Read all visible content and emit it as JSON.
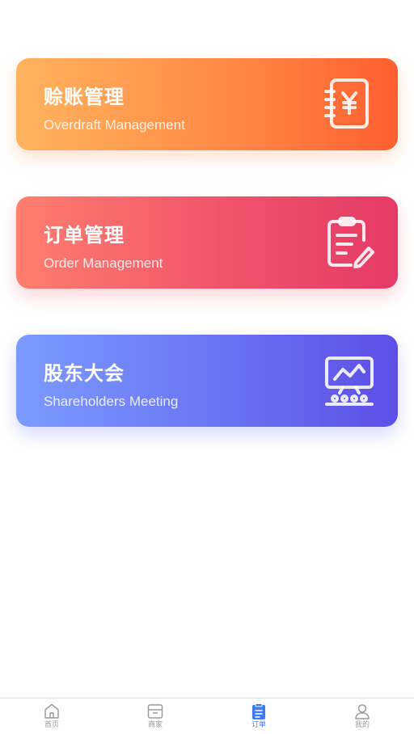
{
  "cards": [
    {
      "title": "赊账管理",
      "subtitle": "Overdraft Management",
      "icon": "ledger-yen-icon"
    },
    {
      "title": "订单管理",
      "subtitle": "Order Management",
      "icon": "clipboard-edit-icon"
    },
    {
      "title": "股东大会",
      "subtitle": "Shareholders Meeting",
      "icon": "presentation-board-icon"
    }
  ],
  "tabbar": {
    "active_color": "#3a7cf4",
    "inactive_color": "#9a9a9a",
    "items": [
      {
        "label": "首页",
        "icon": "home-icon",
        "active": false
      },
      {
        "label": "商家",
        "icon": "store-icon",
        "active": false
      },
      {
        "label": "订单",
        "icon": "order-list-icon",
        "active": true
      },
      {
        "label": "我的",
        "icon": "user-icon",
        "active": false
      }
    ]
  },
  "colors": {
    "overdraft_gradient": [
      "#ffb35f",
      "#ff5f30"
    ],
    "order_gradient": [
      "#ff7e6e",
      "#e43a66"
    ],
    "meeting_gradient": [
      "#7b9bff",
      "#5c4fe6"
    ]
  }
}
